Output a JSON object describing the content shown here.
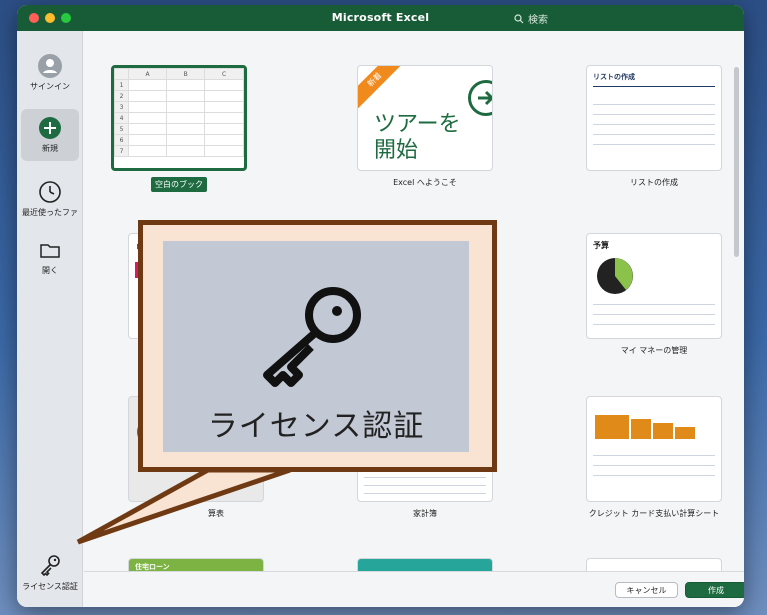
{
  "window": {
    "title": "Microsoft Excel",
    "search_placeholder": "検索"
  },
  "sidebar": {
    "items": [
      {
        "label": "サインイン",
        "icon": "user-icon"
      },
      {
        "label": "新規",
        "icon": "plus-icon",
        "active": true
      },
      {
        "label": "最近使ったファ",
        "icon": "clock-icon"
      },
      {
        "label": "開く",
        "icon": "folder-icon"
      },
      {
        "label": "ライセンス認証",
        "icon": "key-icon"
      }
    ]
  },
  "templates": [
    {
      "label": "空白のブック",
      "selected": true,
      "columns": [
        "A",
        "B",
        "C"
      ],
      "rows": [
        "1",
        "2",
        "3",
        "4",
        "5",
        "6",
        "7"
      ]
    },
    {
      "label": "Excel へようこそ",
      "badge": "新着",
      "text_line1": "ツアーを",
      "text_line2": "開始"
    },
    {
      "label": "リストの作成",
      "doc_title": "リストの作成"
    },
    {
      "label": "",
      "doc_title": "リス"
    },
    {
      "label": "",
      "doc_title": ""
    },
    {
      "label": "マイ マネーの管理",
      "doc_title": "予算"
    },
    {
      "label": "算表",
      "doc_title": ""
    },
    {
      "label": "家計簿",
      "doc_title": ""
    },
    {
      "label": "クレジット カード支払い計算シート",
      "doc_title": ""
    },
    {
      "label": "",
      "doc_title": "住宅ローン"
    },
    {
      "label": "",
      "doc_title": ""
    },
    {
      "label": "",
      "doc_title": ""
    }
  ],
  "buttons": {
    "cancel": "キャンセル",
    "create": "作成"
  },
  "callout": {
    "label": "ライセンス認証",
    "icon": "key-icon"
  },
  "colors": {
    "titlebar": "#185c37",
    "accent": "#1e6b41",
    "ribbon": "#f08a1c",
    "callout_border": "#6f3a13",
    "callout_fill": "#f9e4d4"
  }
}
